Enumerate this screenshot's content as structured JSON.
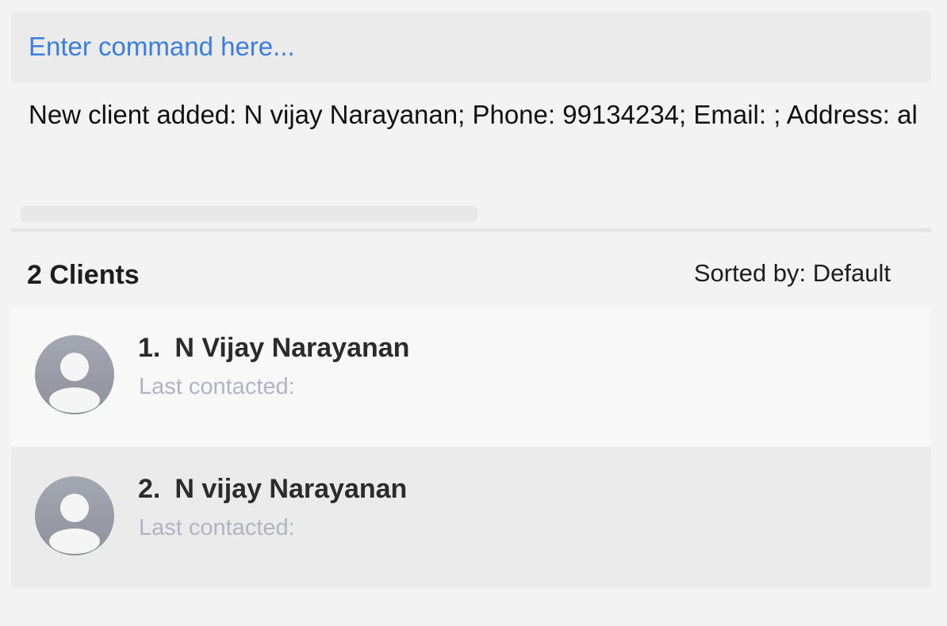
{
  "command": {
    "placeholder": "Enter command here...",
    "value": ""
  },
  "result": {
    "text": "New client added: N vijay Narayanan; Phone: 99134234; Email: ; Address: al"
  },
  "list_header": {
    "count_label": "2 Clients",
    "sort_label": "Sorted by: Default"
  },
  "clients": [
    {
      "index": "1.",
      "name": "N Vijay Narayanan",
      "last_contacted": "Last contacted:"
    },
    {
      "index": "2.",
      "name": "N vijay Narayanan",
      "last_contacted": "Last contacted:"
    }
  ],
  "colors": {
    "placeholder": "#3b7de0",
    "avatar_top": "#a4a8b3",
    "avatar_bottom": "#8e919b",
    "muted_text": "#b3b3c4"
  },
  "icons": {
    "avatar": "user-avatar-icon"
  }
}
